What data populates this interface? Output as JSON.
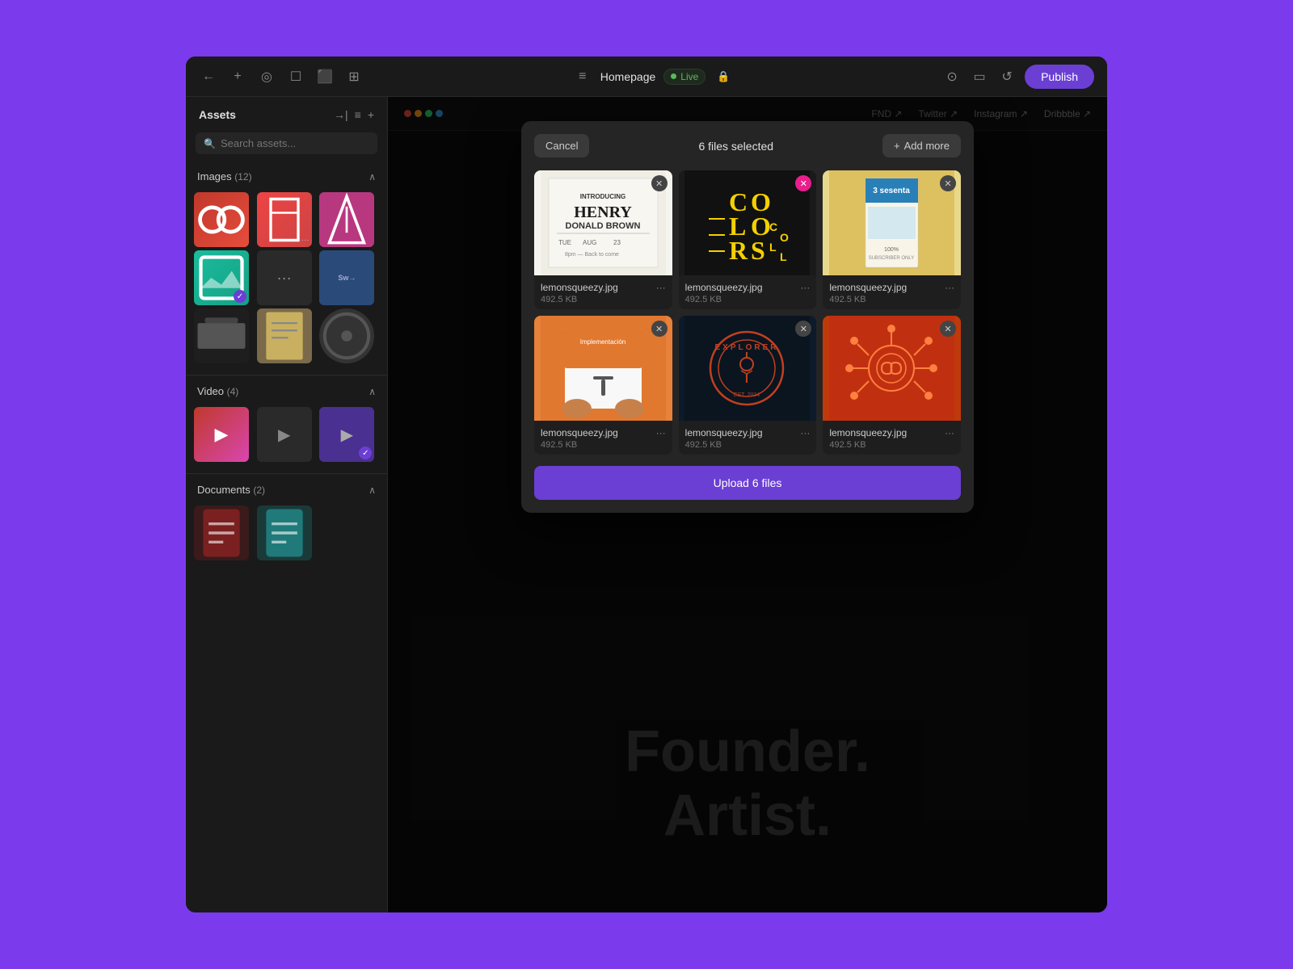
{
  "app": {
    "background_color": "#7c3aed",
    "window_bg": "#111"
  },
  "toolbar": {
    "back_icon": "←",
    "add_icon": "+",
    "target_icon": "◎",
    "file_icon": "☐",
    "folder_icon": "⬜",
    "template_icon": "⊞",
    "menu_icon": "≡",
    "page_title": "Homepage",
    "live_label": "Live",
    "lock_icon": "🔒",
    "view_icon": "⊙",
    "device_icon": "📱",
    "undo_icon": "↺",
    "publish_label": "Publish"
  },
  "sidebar": {
    "title": "Assets",
    "export_icon": "→|",
    "list_icon": "≡",
    "add_icon": "+",
    "search_placeholder": "Search assets...",
    "sections": [
      {
        "name": "Images",
        "count": 12,
        "expanded": true,
        "thumbnails": [
          {
            "color": "thumb-red",
            "text": "",
            "selected": false,
            "has_more": false
          },
          {
            "color": "thumb-pink",
            "text": "",
            "selected": false,
            "has_more": true
          },
          {
            "color": "thumb-pink-light",
            "text": "",
            "selected": false,
            "has_more": false
          },
          {
            "color": "thumb-teal",
            "text": "",
            "selected": true,
            "has_more": false
          },
          {
            "color": "thumb-gray",
            "text": "···",
            "selected": false,
            "has_more": false
          },
          {
            "color": "thumb-blue",
            "text": "",
            "selected": false,
            "has_more": false
          },
          {
            "color": "thumb-dark",
            "text": "",
            "selected": false,
            "has_more": false
          },
          {
            "color": "thumb-beige",
            "text": "",
            "selected": false,
            "has_more": false
          },
          {
            "color": "thumb-circle",
            "text": "",
            "selected": false,
            "has_more": false
          }
        ]
      },
      {
        "name": "Video",
        "count": 4,
        "expanded": true,
        "thumbnails": [
          {
            "color": "thumb-video-pink",
            "selected": false
          },
          {
            "color": "thumb-video-gray",
            "selected": false
          },
          {
            "color": "thumb-video-purple",
            "selected": true
          }
        ]
      },
      {
        "name": "Documents",
        "count": 2,
        "expanded": true,
        "thumbnails": [
          {
            "color": "thumb-doc-red",
            "selected": false
          },
          {
            "color": "thumb-doc-teal",
            "selected": false
          }
        ]
      }
    ]
  },
  "modal": {
    "cancel_label": "Cancel",
    "title": "6 files selected",
    "add_more_label": "Add more",
    "upload_label": "Upload 6 files",
    "files": [
      {
        "name": "lemonsqueezy.jpg",
        "size": "492.5 KB",
        "preview_type": "henry-poster",
        "close_type": "normal"
      },
      {
        "name": "lemonsqueezy.jpg",
        "size": "492.5 KB",
        "preview_type": "colors-collector",
        "close_type": "pink"
      },
      {
        "name": "lemonsqueezy.jpg",
        "size": "492.5 KB",
        "preview_type": "sesenta-magazine",
        "close_type": "normal"
      },
      {
        "name": "lemonsqueezy.jpg",
        "size": "492.5 KB",
        "preview_type": "implementacion",
        "close_type": "normal"
      },
      {
        "name": "lemonsqueezy.jpg",
        "size": "492.5 KB",
        "preview_type": "explorer",
        "close_type": "normal"
      },
      {
        "name": "lemonsqueezy.jpg",
        "size": "492.5 KB",
        "preview_type": "orange-art",
        "close_type": "normal"
      }
    ]
  },
  "canvas": {
    "hero_line1": "Founder.",
    "hero_line2": "Artist."
  },
  "brand_dots": [
    {
      "color": "#e74c3c"
    },
    {
      "color": "#f39c12"
    },
    {
      "color": "#2ecc71"
    },
    {
      "color": "#3498db"
    }
  ],
  "top_nav_links": [
    "FND ↗",
    "Twitter ↗",
    "Instagram ↗",
    "Dribbble ↗"
  ]
}
